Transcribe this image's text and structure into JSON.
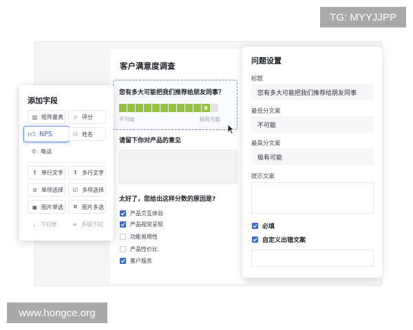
{
  "watermarks": {
    "tg": "TG: MYYJJPP",
    "site": "www.hongce.org"
  },
  "form": {
    "title": "客户满意度调查",
    "q1": {
      "title": "您有多大可能把我们推荐给朋友同事？",
      "selected": "9",
      "low_label": "不可能",
      "high_label": "极有可能"
    },
    "q2": {
      "title": "请留下你对产品的意见"
    },
    "q3": {
      "title": "太好了，您给出这样分数的原因是?",
      "options": [
        {
          "label": "产品交互体验",
          "checked": true
        },
        {
          "label": "产品视觉呈现",
          "checked": true
        },
        {
          "label": "功能易用性",
          "checked": false
        },
        {
          "label": "产品性价比",
          "checked": false
        },
        {
          "label": "客户服务",
          "checked": true
        }
      ]
    }
  },
  "fields_panel": {
    "title": "添加字段",
    "items": [
      {
        "label": "矩阵量表",
        "icon": "matrix-icon"
      },
      {
        "label": "评分",
        "icon": "star-icon"
      },
      {
        "label": "NPS",
        "icon": "thumb-up-icon"
      },
      {
        "label": "姓名",
        "icon": "person-icon"
      },
      {
        "label": "电话",
        "icon": "phone-icon"
      },
      {
        "label": "单行文字",
        "icon": "text-icon"
      },
      {
        "label": "多行文字",
        "icon": "text-icon"
      },
      {
        "label": "单项选择",
        "icon": "radio-check-icon"
      },
      {
        "label": "多项选择",
        "icon": "checkbox-icon"
      },
      {
        "label": "图片单选",
        "icon": "image-icon"
      },
      {
        "label": "图片多选",
        "icon": "image-multi-icon"
      },
      {
        "label": "下拉框",
        "icon": "chevron-down-icon"
      },
      {
        "label": "多级下拉",
        "icon": "cascade-icon"
      }
    ]
  },
  "settings": {
    "title": "问题设置",
    "title_label": "标题",
    "title_value": "您有多大可能把我们推荐给朋友同事",
    "min_label": "最低分文案",
    "min_value": "不可能",
    "max_label": "最高分文案",
    "max_value": "极有可能",
    "hint_label": "提示文案",
    "hint_value": "",
    "required_label": "必填",
    "required_checked": true,
    "custom_error_label": "自定义出错文案",
    "custom_error_checked": true,
    "custom_error_value": ""
  },
  "colors": {
    "accent": "#3b68d9",
    "nps_fill": "#95c23d"
  }
}
